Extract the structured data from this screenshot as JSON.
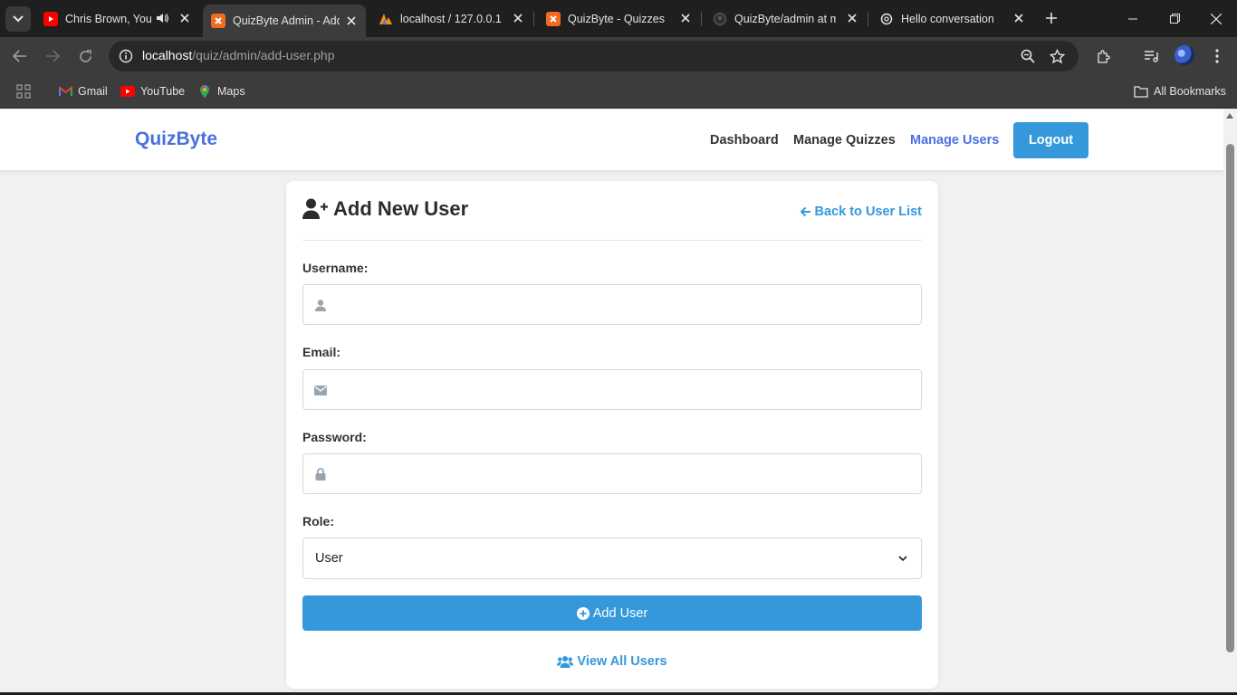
{
  "browser": {
    "tabs": [
      {
        "title": "Chris Brown, Your",
        "favicon": "youtube-icon",
        "audio": true,
        "active": false
      },
      {
        "title": "QuizByte Admin - Add",
        "favicon": "xampp-icon",
        "active": true
      },
      {
        "title": "localhost / 127.0.0.1 /",
        "favicon": "phpmyadmin-icon",
        "active": false
      },
      {
        "title": "QuizByte - Quizzes",
        "favicon": "xampp-icon",
        "active": false
      },
      {
        "title": "QuizByte/admin at m",
        "favicon": "github-icon",
        "active": false
      },
      {
        "title": "Hello conversation",
        "favicon": "openai-icon",
        "active": false
      }
    ],
    "url_host": "localhost",
    "url_path": "/quiz/admin/add-user.php",
    "bookmarks": [
      {
        "label": "Gmail",
        "icon": "gmail-icon"
      },
      {
        "label": "YouTube",
        "icon": "youtube-icon"
      },
      {
        "label": "Maps",
        "icon": "maps-icon"
      }
    ],
    "all_bookmarks": "All Bookmarks"
  },
  "navbar": {
    "brand": "QuizByte",
    "links": [
      "Dashboard",
      "Manage Quizzes",
      "Manage Users"
    ],
    "active_link": "Manage Users",
    "logout": "Logout"
  },
  "form": {
    "title": "Add New User",
    "back_link": "Back to User List",
    "username_label": "Username:",
    "username_value": "",
    "email_label": "Email:",
    "email_value": "",
    "password_label": "Password:",
    "password_value": "",
    "role_label": "Role:",
    "role_value": "User",
    "submit": "Add User",
    "view_all": "View All Users"
  },
  "colors": {
    "brand": "#4a6fe0",
    "primary": "#3498db",
    "background": "#f1f1f1"
  }
}
